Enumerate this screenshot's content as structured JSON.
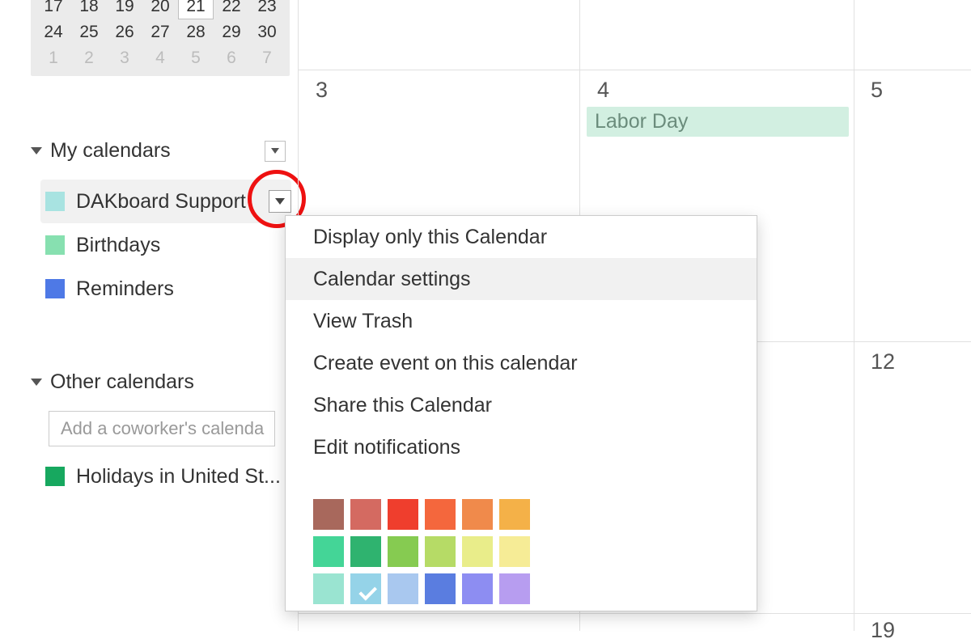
{
  "mini_calendar": {
    "rows": [
      {
        "days": [
          {
            "n": "17",
            "other": false,
            "today": false
          },
          {
            "n": "18",
            "other": false,
            "today": false
          },
          {
            "n": "19",
            "other": false,
            "today": false
          },
          {
            "n": "20",
            "other": false,
            "today": false
          },
          {
            "n": "21",
            "other": false,
            "today": true
          },
          {
            "n": "22",
            "other": false,
            "today": false
          },
          {
            "n": "23",
            "other": false,
            "today": false
          }
        ]
      },
      {
        "days": [
          {
            "n": "24",
            "other": false,
            "today": false
          },
          {
            "n": "25",
            "other": false,
            "today": false
          },
          {
            "n": "26",
            "other": false,
            "today": false
          },
          {
            "n": "27",
            "other": false,
            "today": false
          },
          {
            "n": "28",
            "other": false,
            "today": false
          },
          {
            "n": "29",
            "other": false,
            "today": false
          },
          {
            "n": "30",
            "other": false,
            "today": false
          }
        ]
      },
      {
        "days": [
          {
            "n": "1",
            "other": true,
            "today": false
          },
          {
            "n": "2",
            "other": true,
            "today": false
          },
          {
            "n": "3",
            "other": true,
            "today": false
          },
          {
            "n": "4",
            "other": true,
            "today": false
          },
          {
            "n": "5",
            "other": true,
            "today": false
          },
          {
            "n": "6",
            "other": true,
            "today": false
          },
          {
            "n": "7",
            "other": true,
            "today": false
          }
        ]
      }
    ]
  },
  "sections": {
    "my_calendars": {
      "title": "My calendars"
    },
    "other_calendars": {
      "title": "Other calendars"
    }
  },
  "my_calendars": [
    {
      "name": "DAKboard Support",
      "color": "#a8e3e1",
      "selected": true,
      "has_menu": true
    },
    {
      "name": "Birthdays",
      "color": "#87e0b0",
      "selected": false,
      "has_menu": false
    },
    {
      "name": "Reminders",
      "color": "#4e79e6",
      "selected": false,
      "has_menu": false
    }
  ],
  "other_calendars": [
    {
      "name": "Holidays in United St...",
      "color": "#17a85f"
    }
  ],
  "coworker_placeholder": "Add a coworker's calenda",
  "menu": {
    "items": [
      {
        "label": "Display only this Calendar",
        "hover": false
      },
      {
        "label": "Calendar settings",
        "hover": true
      },
      {
        "label": "View Trash",
        "hover": false
      },
      {
        "label": "Create event on this calendar",
        "hover": false
      },
      {
        "label": "Share this Calendar",
        "hover": false
      },
      {
        "label": "Edit notifications",
        "hover": false
      }
    ],
    "colors": [
      [
        "#a8685c",
        "#d46a61",
        "#ef3e2d",
        "#f4673d",
        "#f08a4b",
        "#f4b148"
      ],
      [
        "#44d597",
        "#2fb36f",
        "#86cb51",
        "#b6db66",
        "#e9ed8a",
        "#f6ec96"
      ],
      [
        "#9ae4d1",
        "#95d3e8",
        "#a9c8ef",
        "#5a7de0",
        "#8d8df2",
        "#b79df0"
      ]
    ],
    "checked_color": "#95d3e8",
    "checked_row": 2,
    "checked_col": 1
  },
  "grid": {
    "day_numbers": {
      "r1c1": "3",
      "r1c2": "4",
      "r1c3": "5",
      "r2c3": "12",
      "r3c3": "19"
    },
    "events": [
      {
        "label": "Labor Day",
        "col": 2,
        "row": 1
      }
    ]
  }
}
